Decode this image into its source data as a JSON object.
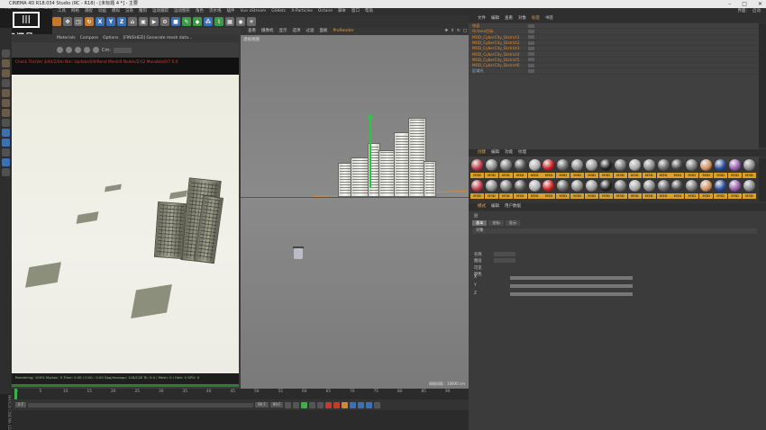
{
  "window": {
    "title": "CINEMA 4D R18.034 Studio (RC - R18) - [未标题 4 *] - 主要"
  },
  "menubar": {
    "items": [
      "文件",
      "编辑",
      "创建",
      "选择",
      "工具",
      "网格",
      "捕捉",
      "动画",
      "模拟",
      "渲染",
      "雕刻",
      "运动跟踪",
      "运动图形",
      "角色",
      "流水线",
      "插件",
      "Vue xStream",
      "GSKetc",
      "X-Particles",
      "Octane",
      "脚本",
      "窗口",
      "帮助"
    ],
    "right": [
      "界面:",
      "启动"
    ]
  },
  "logo": {
    "cube_text": "|||",
    "name": "房间号",
    "number": "6020523"
  },
  "render_view": {
    "menus": [
      "Materials",
      "Compare",
      "Options",
      "[FINISHED] Generate mesh data..."
    ],
    "zoom_label": "Cm:",
    "status": "Check Tris/Ver 3/40/2/0m Nm: Update/0/0/Rend Mesh/4 Nodes/2/12 Movable/0/7 E:0",
    "stats": "Rendering: 100%   Mo/sec: 0   Time: 0.00 / 0.00 : 0.00   Spp/maxspp: 128/128   Tri: 0.0 / Mesh: 0 / Hair: 0   GPU: 0"
  },
  "viewport": {
    "menus": [
      "查看",
      "摄像机",
      "显示",
      "选项",
      "过滤",
      "面板",
      "ProRender"
    ],
    "active": "ProRender",
    "label": "透视视图",
    "footer": "网格间距 : 10000 cm"
  },
  "objects": {
    "tabs": [
      "文件",
      "编辑",
      "查看",
      "对象",
      "标签",
      "书签"
    ],
    "active": "标签",
    "rows": [
      {
        "name": "地面",
        "color": "orange"
      },
      {
        "name": "Octane目标",
        "color": "orange"
      },
      {
        "name": "MOD_CyberCity_District1",
        "color": "orange"
      },
      {
        "name": "MOD_CyberCity_District2",
        "color": "orange"
      },
      {
        "name": "MOD_CyberCity_District3",
        "color": "orange"
      },
      {
        "name": "MOD_CyberCity_District4",
        "color": "orange"
      },
      {
        "name": "MOD_CyberCity_District5",
        "color": "orange"
      },
      {
        "name": "MOD_CyberCity_District6",
        "color": "orange"
      },
      {
        "name": "区域光",
        "color": "blue"
      }
    ]
  },
  "materials": {
    "tabs": [
      "创建",
      "编辑",
      "功能",
      "纹理"
    ],
    "active": "创建",
    "label": "M3D",
    "count": 40
  },
  "attributes": {
    "tabs": [
      "模式",
      "编辑",
      "用户数据"
    ],
    "active": "模式",
    "title": "层",
    "subtabs": [
      "基本",
      "坐标",
      "显示"
    ],
    "section": "对象",
    "rows": [
      "名称",
      "图层",
      "可见",
      "颜色",
      "X",
      "Y",
      "Z"
    ]
  },
  "timeline": {
    "ticks": [
      "0",
      "5",
      "10",
      "15",
      "20",
      "25",
      "30",
      "35",
      "40",
      "45",
      "50",
      "55",
      "60",
      "65",
      "70",
      "75",
      "80",
      "85",
      "90"
    ],
    "frame": "0 F",
    "start": "0 F",
    "end": "90 F",
    "end2": "90 F"
  },
  "maxon": {
    "label": "MAXON CINEMA 4D"
  }
}
